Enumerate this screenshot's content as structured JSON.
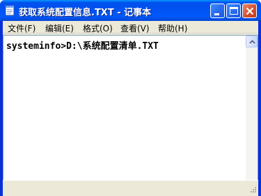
{
  "window": {
    "title": "获取系统配置信息.TXT - 记事本",
    "icon": "notepad-icon"
  },
  "caption_buttons": {
    "minimize": "minimize-icon",
    "maximize": "maximize-icon",
    "close": "close-icon"
  },
  "menu": {
    "items": [
      {
        "label": "文件(F)"
      },
      {
        "label": "编辑(E)"
      },
      {
        "label": "格式(O)"
      },
      {
        "label": "查看(V)"
      },
      {
        "label": "帮助(H)"
      }
    ]
  },
  "editor": {
    "content": "systeminfo>D:\\系统配置清单.TXT"
  },
  "colors": {
    "titlebar": "#0055f6",
    "frame": "#0831d9",
    "close_button": "#d6502e",
    "menu_bg": "#ece9d8"
  }
}
